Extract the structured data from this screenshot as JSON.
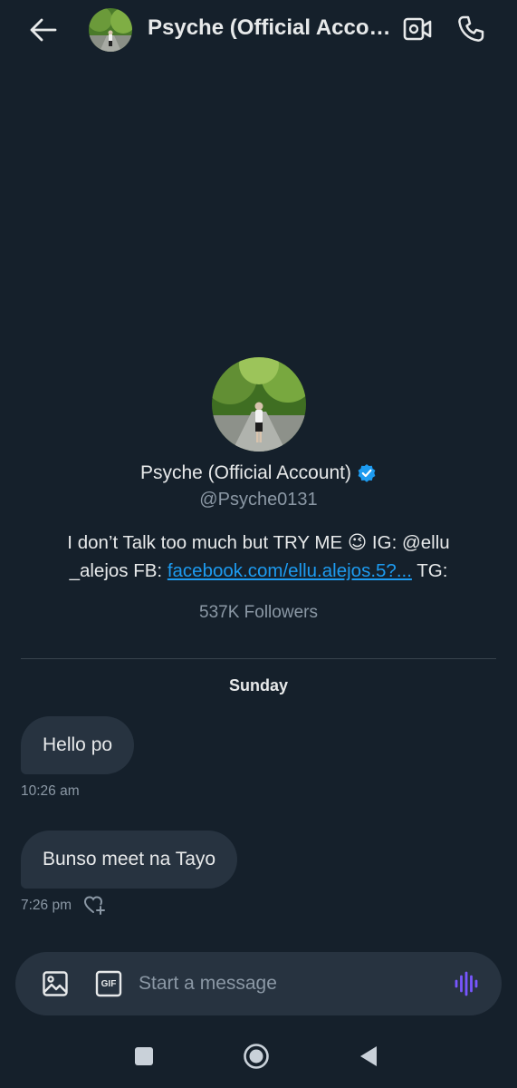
{
  "header": {
    "title": "Psyche (Official Account)"
  },
  "profile": {
    "name": "Psyche (Official Account)",
    "handle": "@Psyche0131",
    "bio_text": "I don’t Talk too much but TRY ME 😉 IG: @ellu _alejos FB: ",
    "bio_link": "facebook.com/ellu.alejos.5?...",
    "bio_suffix": " TG:",
    "followers": "537K Followers",
    "verified_color": "#1d9bf0"
  },
  "conversation": {
    "day_label": "Sunday",
    "messages": [
      {
        "text": "Hello po",
        "time": "10:26 am"
      },
      {
        "text": "Bunso meet na Tayo",
        "time": "7:26 pm"
      }
    ]
  },
  "composer": {
    "placeholder": "Start a message",
    "gif_label": "GIF"
  },
  "icons": {
    "back": "arrow-left-icon",
    "video": "video-call-icon",
    "phone": "phone-icon",
    "image": "image-icon",
    "gif": "gif-icon",
    "voice": "voice-wave-icon",
    "reaction": "heart-plus-icon"
  },
  "colors": {
    "background": "#15202b",
    "bubble": "#273340",
    "accent": "#1d9bf0",
    "voice": "#7856ff"
  }
}
